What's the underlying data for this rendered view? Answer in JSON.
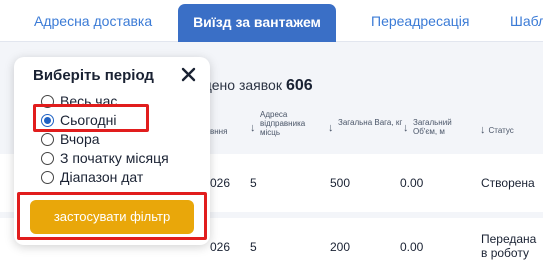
{
  "tabs": [
    "Адресна доставка",
    "Виїзд за вантажем",
    "Переадресація",
    "Шабло"
  ],
  "found": {
    "label": "айдено заявок",
    "count": "606"
  },
  "table": {
    "headers": {
      "date_fragment": "вння",
      "address": "Адреса відправника місць",
      "weight": "Загальна Вага, кг",
      "volume": "Загальний Об'єм, м",
      "status": "Статус"
    },
    "rows": [
      {
        "date": "026",
        "places": "5",
        "weight": "500",
        "volume": "0.00",
        "status": "Створена"
      },
      {
        "date": "026",
        "places": "5",
        "weight": "200",
        "volume": "0.00",
        "status": "Передана в роботу"
      }
    ]
  },
  "filter": {
    "title": "Виберіть період",
    "options": [
      "Весь час",
      "Сьогодні",
      "Вчора",
      "З початку місяця",
      "Діапазон дат"
    ],
    "selected": "Сьогодні",
    "apply_label": "застосувати фільтр"
  },
  "colors": {
    "tab_active": "#3a6fc6",
    "tab_text": "#3b7bd6",
    "apply": "#e9a70a",
    "highlight": "#e11d1d",
    "radio": "#1f62c4"
  }
}
